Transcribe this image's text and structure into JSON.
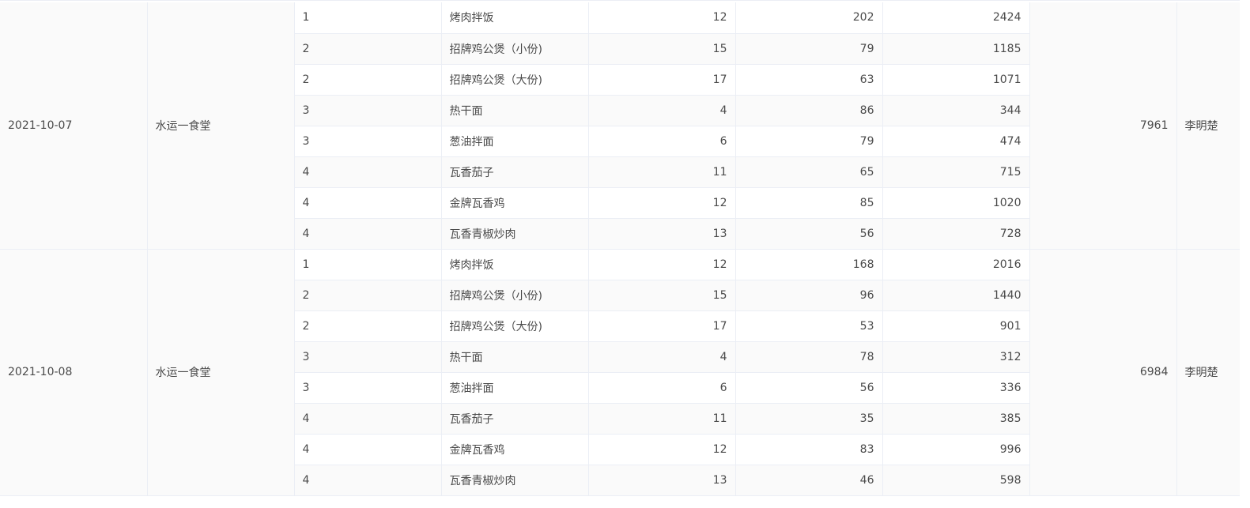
{
  "table": {
    "groups": [
      {
        "date": "2021-10-07",
        "canteen": "水运一食堂",
        "total": "7961",
        "manager": "李明楚",
        "rows": [
          {
            "window": "1",
            "dish": "烤肉拌饭",
            "price": "12",
            "qty": "202",
            "amount": "2424"
          },
          {
            "window": "2",
            "dish": "招牌鸡公煲（小份)",
            "price": "15",
            "qty": "79",
            "amount": "1185"
          },
          {
            "window": "2",
            "dish": "招牌鸡公煲（大份)",
            "price": "17",
            "qty": "63",
            "amount": "1071"
          },
          {
            "window": "3",
            "dish": "热干面",
            "price": "4",
            "qty": "86",
            "amount": "344"
          },
          {
            "window": "3",
            "dish": "葱油拌面",
            "price": "6",
            "qty": "79",
            "amount": "474"
          },
          {
            "window": "4",
            "dish": "瓦香茄子",
            "price": "11",
            "qty": "65",
            "amount": "715"
          },
          {
            "window": "4",
            "dish": "金牌瓦香鸡",
            "price": "12",
            "qty": "85",
            "amount": "1020"
          },
          {
            "window": "4",
            "dish": "瓦香青椒炒肉",
            "price": "13",
            "qty": "56",
            "amount": "728"
          }
        ]
      },
      {
        "date": "2021-10-08",
        "canteen": "水运一食堂",
        "total": "6984",
        "manager": "李明楚",
        "rows": [
          {
            "window": "1",
            "dish": "烤肉拌饭",
            "price": "12",
            "qty": "168",
            "amount": "2016"
          },
          {
            "window": "2",
            "dish": "招牌鸡公煲（小份)",
            "price": "15",
            "qty": "96",
            "amount": "1440"
          },
          {
            "window": "2",
            "dish": "招牌鸡公煲（大份)",
            "price": "17",
            "qty": "53",
            "amount": "901"
          },
          {
            "window": "3",
            "dish": "热干面",
            "price": "4",
            "qty": "78",
            "amount": "312"
          },
          {
            "window": "3",
            "dish": "葱油拌面",
            "price": "6",
            "qty": "56",
            "amount": "336"
          },
          {
            "window": "4",
            "dish": "瓦香茄子",
            "price": "11",
            "qty": "35",
            "amount": "385"
          },
          {
            "window": "4",
            "dish": "金牌瓦香鸡",
            "price": "12",
            "qty": "83",
            "amount": "996"
          },
          {
            "window": "4",
            "dish": "瓦香青椒炒肉",
            "price": "13",
            "qty": "46",
            "amount": "598"
          }
        ]
      }
    ]
  }
}
